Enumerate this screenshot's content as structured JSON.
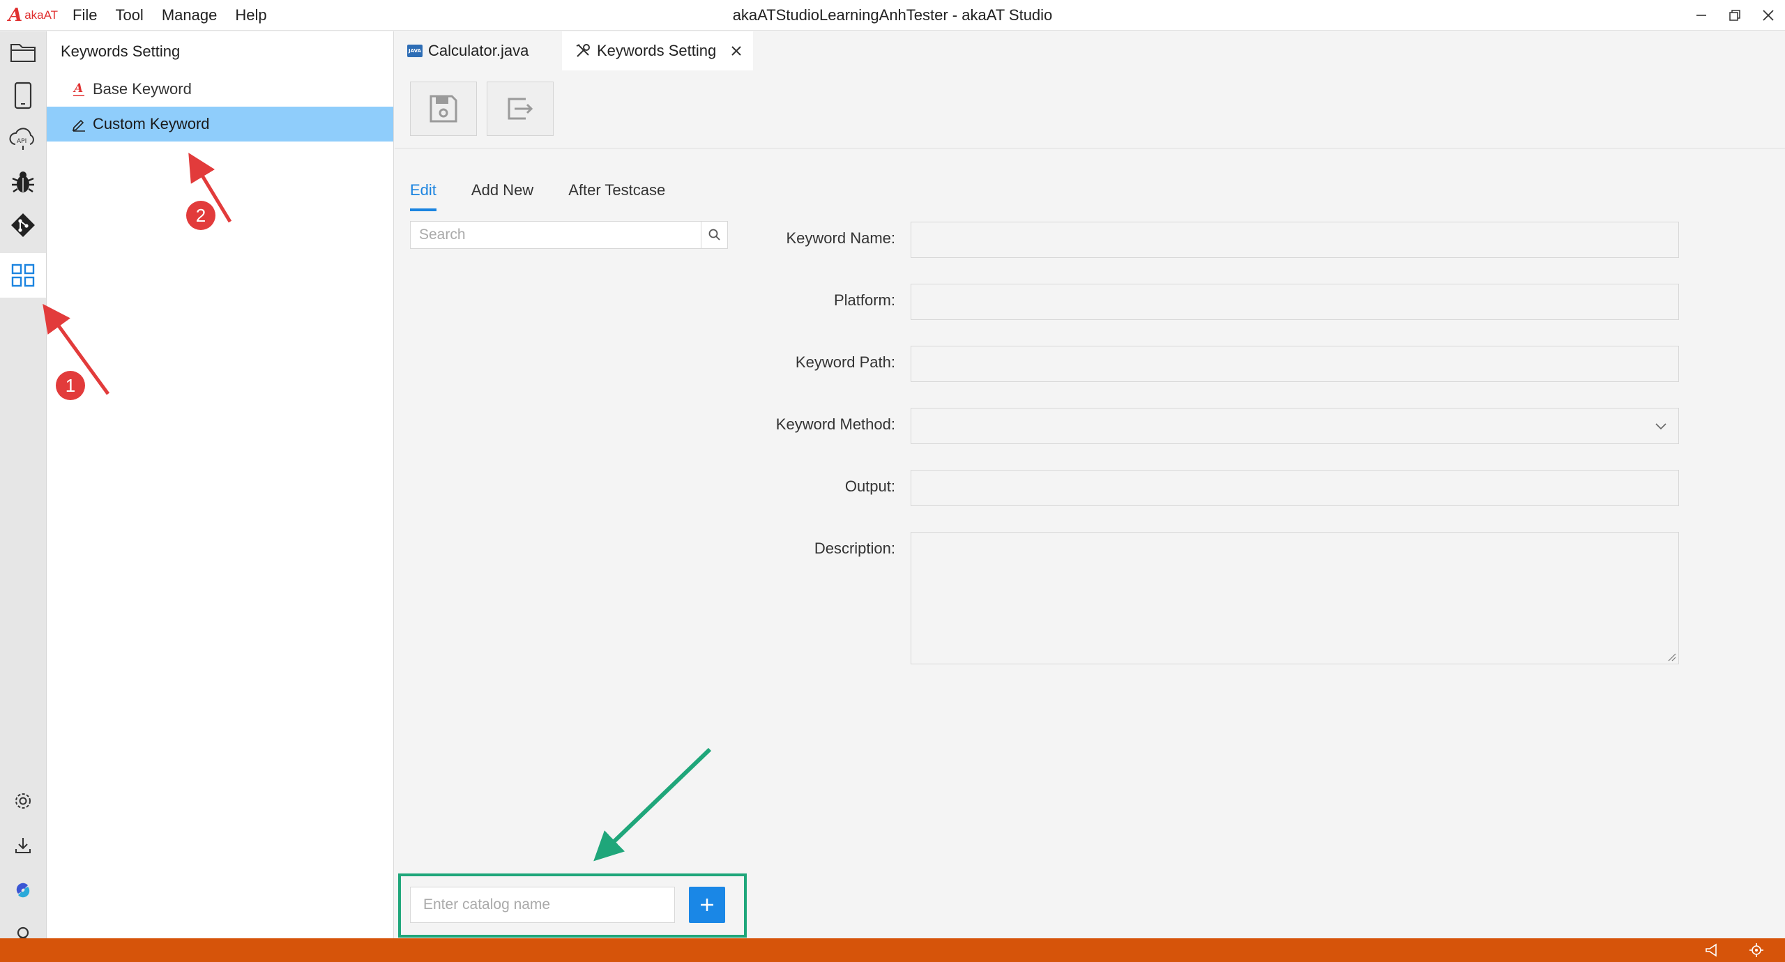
{
  "app": {
    "logo_text": "akaAT",
    "window_title": "akaATStudioLearningAnhTester - akaAT Studio"
  },
  "menu": [
    "File",
    "Tool",
    "Manage",
    "Help"
  ],
  "activity_bar": {
    "top_items": [
      "explorer-icon",
      "mobile-icon",
      "api-icon",
      "bug-icon",
      "git-icon",
      "keywords-grid-icon"
    ],
    "bottom_items": [
      "settings-icon",
      "download-icon",
      "plugin-icon",
      "account-icon"
    ],
    "active": "keywords-grid-icon"
  },
  "explorer": {
    "title": "Keywords Setting",
    "items": [
      {
        "label": "Base Keyword",
        "icon": "akaat-logo-icon",
        "selected": false
      },
      {
        "label": "Custom Keyword",
        "icon": "pencil-icon",
        "selected": true
      }
    ]
  },
  "tabs": [
    {
      "label": "Calculator.java",
      "badge": "JAVA",
      "active": false
    },
    {
      "label": "Keywords Setting",
      "active": true,
      "closable": true
    }
  ],
  "toolbar": {
    "buttons": [
      "save-icon",
      "export-icon"
    ]
  },
  "subtabs": [
    {
      "label": "Edit",
      "active": true
    },
    {
      "label": "Add New",
      "active": false
    },
    {
      "label": "After Testcase",
      "active": false
    }
  ],
  "search": {
    "placeholder": "Search",
    "value": ""
  },
  "form": {
    "keyword_name": {
      "label": "Keyword Name",
      "value": ""
    },
    "platform": {
      "label": "Platform",
      "value": ""
    },
    "keyword_path": {
      "label": "Keyword Path",
      "value": ""
    },
    "keyword_method": {
      "label": "Keyword Method",
      "value": ""
    },
    "output": {
      "label": "Output",
      "value": ""
    },
    "description": {
      "label": "Description",
      "value": ""
    }
  },
  "catalog": {
    "placeholder": "Enter catalog name",
    "value": ""
  },
  "annotations": {
    "marker_1": "1",
    "marker_2": "2",
    "red_color": "#e23b3b",
    "green_color": "#1fa67a"
  },
  "colors": {
    "accent": "#1b84e0",
    "selection": "#8fcdfb",
    "status_bar": "#d6540a"
  }
}
